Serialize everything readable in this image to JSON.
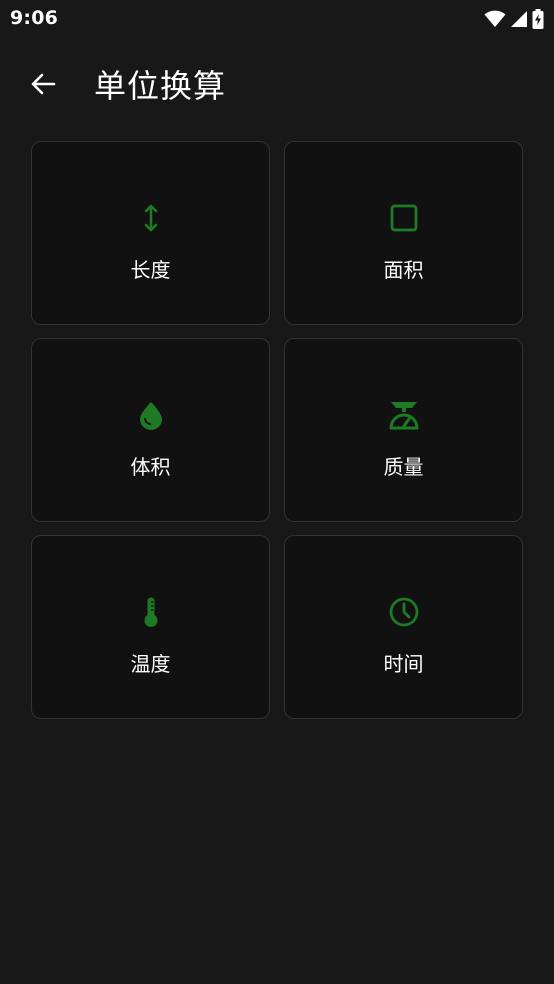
{
  "status_bar": {
    "time": "9:06",
    "icons": [
      "wifi-icon",
      "signal-icon",
      "battery-charging-icon"
    ]
  },
  "app_bar": {
    "back_icon": "arrow-back-icon",
    "title": "单位换算"
  },
  "colors": {
    "background": "#181818",
    "card_background": "#111111",
    "card_border": "#333333",
    "accent": "#1e7a24",
    "text": "#ffffff"
  },
  "categories": [
    {
      "label": "长度",
      "icon": "vertical-arrows-icon"
    },
    {
      "label": "面积",
      "icon": "square-outline-icon"
    },
    {
      "label": "体积",
      "icon": "water-drop-icon"
    },
    {
      "label": "质量",
      "icon": "scale-icon"
    },
    {
      "label": "温度",
      "icon": "thermometer-icon"
    },
    {
      "label": "时间",
      "icon": "clock-icon"
    }
  ]
}
